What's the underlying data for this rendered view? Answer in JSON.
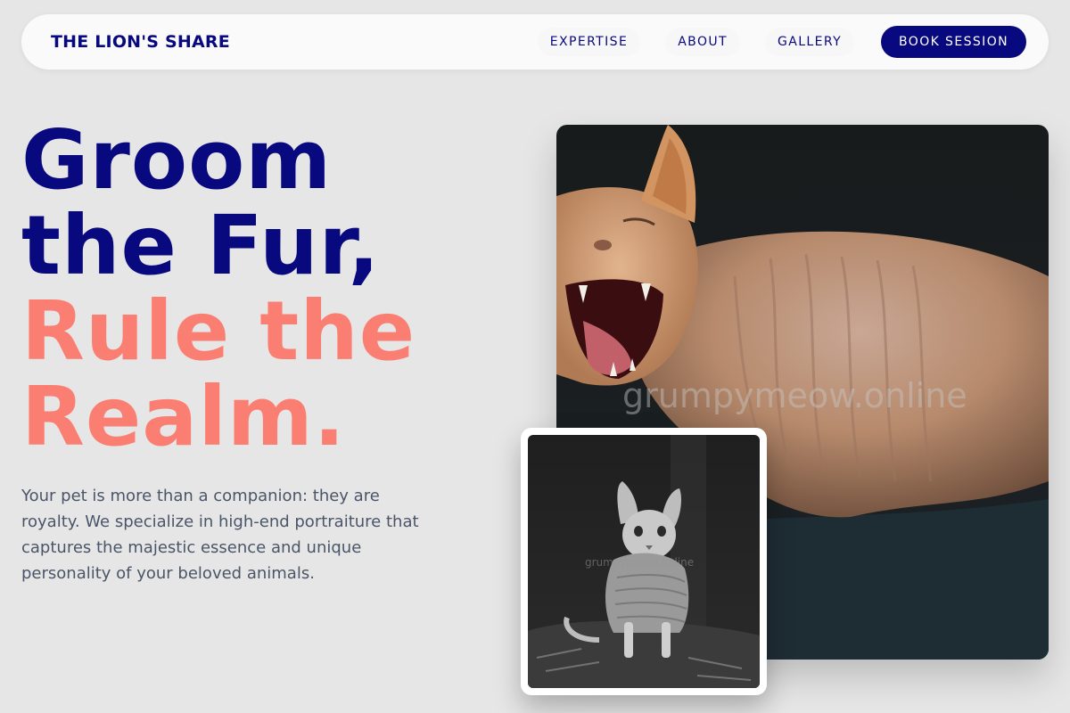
{
  "brand": "THE LION'S SHARE",
  "nav": {
    "links": [
      "EXPERTISE",
      "ABOUT",
      "GALLERY"
    ],
    "cta": "BOOK SESSION"
  },
  "headline": {
    "line1": "Groom",
    "line2": "the Fur,",
    "line3": "Rule the",
    "line4": "Realm."
  },
  "intro": "Your pet is more than a companion: they are royalty. We specialize in high-end portraiture that captures the majestic essence and unique personality of your beloved animals.",
  "images": {
    "hero_watermark": "grumpymeow.online",
    "thumb_watermark": "grumpymeow.online"
  },
  "colors": {
    "navy": "#08087f",
    "coral": "#fa7f72",
    "background": "#e6e6e6"
  }
}
